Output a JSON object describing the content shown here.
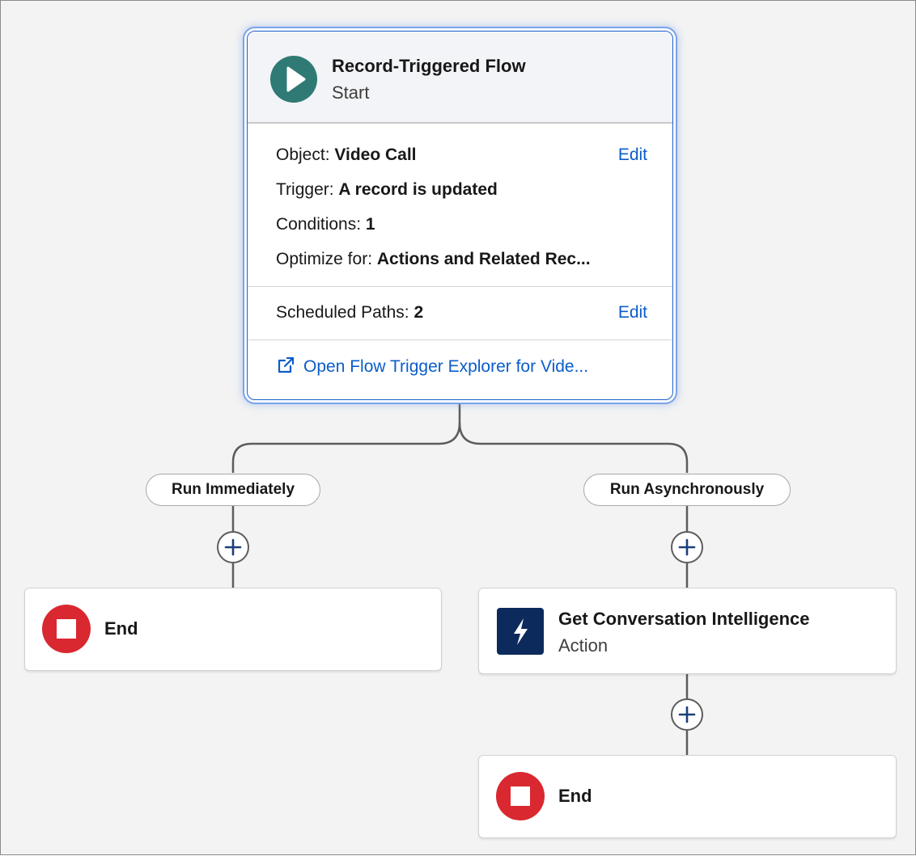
{
  "start": {
    "title": "Record-Triggered Flow",
    "subtitle": "Start",
    "object_label": "Object:",
    "object_value": "Video Call",
    "trigger_label": "Trigger:",
    "trigger_value": "A record is updated",
    "conditions_label": "Conditions:",
    "conditions_value": "1",
    "optimize_label": "Optimize for:",
    "optimize_value": "Actions and Related Rec...",
    "scheduled_label": "Scheduled Paths:",
    "scheduled_value": "2",
    "edit_label": "Edit",
    "explorer_link": "Open Flow Trigger Explorer for Vide...",
    "icon": "play-icon",
    "icon_color": "#2f7a74"
  },
  "paths": [
    {
      "label": "Run Immediately",
      "nodes": [
        {
          "title": "End",
          "icon": "stop-icon",
          "icon_color": "#d9282f"
        }
      ]
    },
    {
      "label": "Run Asynchronously",
      "nodes": [
        {
          "title": "Get Conversation Intelligence",
          "subtitle": "Action",
          "icon": "lightning-icon",
          "icon_color": "#0c2a5c"
        },
        {
          "title": "End",
          "icon": "stop-icon",
          "icon_color": "#d9282f"
        }
      ]
    }
  ],
  "link_color": "#0b5cca",
  "add_icon": "plus-icon"
}
